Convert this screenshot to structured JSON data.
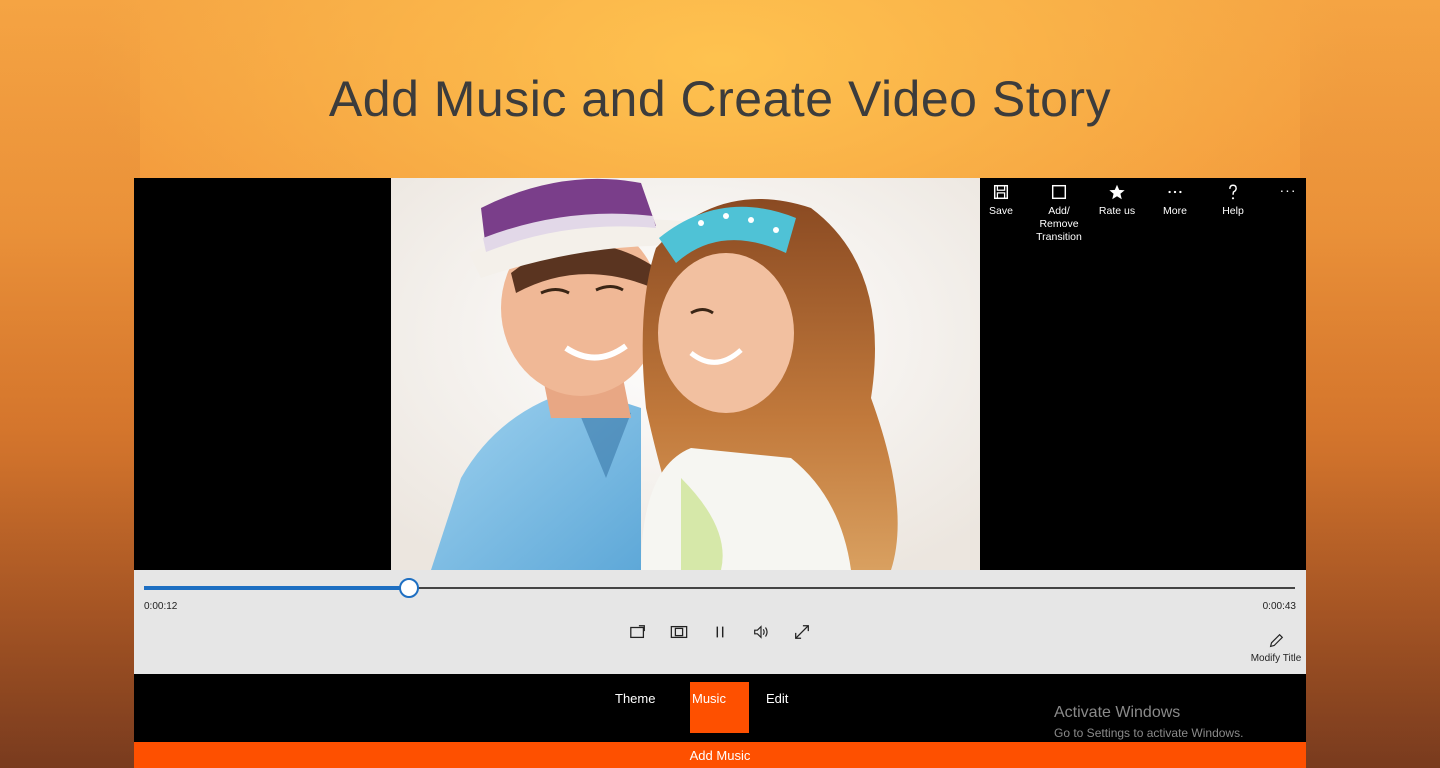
{
  "headline": "Add Music and Create Video Story",
  "commands": [
    {
      "label": "Save",
      "icon": "save-icon"
    },
    {
      "label": "Add/ Remove Transition",
      "icon": "square-icon"
    },
    {
      "label": "Rate us",
      "icon": "star-icon"
    },
    {
      "label": "More",
      "icon": "more-dots-icon"
    },
    {
      "label": "Help",
      "icon": "question-icon"
    }
  ],
  "overflow": "···",
  "player": {
    "current_time": "0:00:12",
    "total_time": "0:00:43",
    "progress": 0.23,
    "modify_title": "Modify Title",
    "buttons": [
      "cast-icon",
      "aspect-icon",
      "pause-icon",
      "volume-icon",
      "fullscreen-icon"
    ]
  },
  "tabs": [
    {
      "label": "Theme",
      "active": false
    },
    {
      "label": "Music",
      "active": true
    },
    {
      "label": "Edit",
      "active": false
    }
  ],
  "watermark": {
    "title": "Activate Windows",
    "subtitle": "Go to Settings to activate Windows."
  },
  "action_bar": "Add Music",
  "colors": {
    "accent": "#fe5000",
    "progress": "#1e6fc2",
    "control_bg": "#e6e6e6"
  }
}
